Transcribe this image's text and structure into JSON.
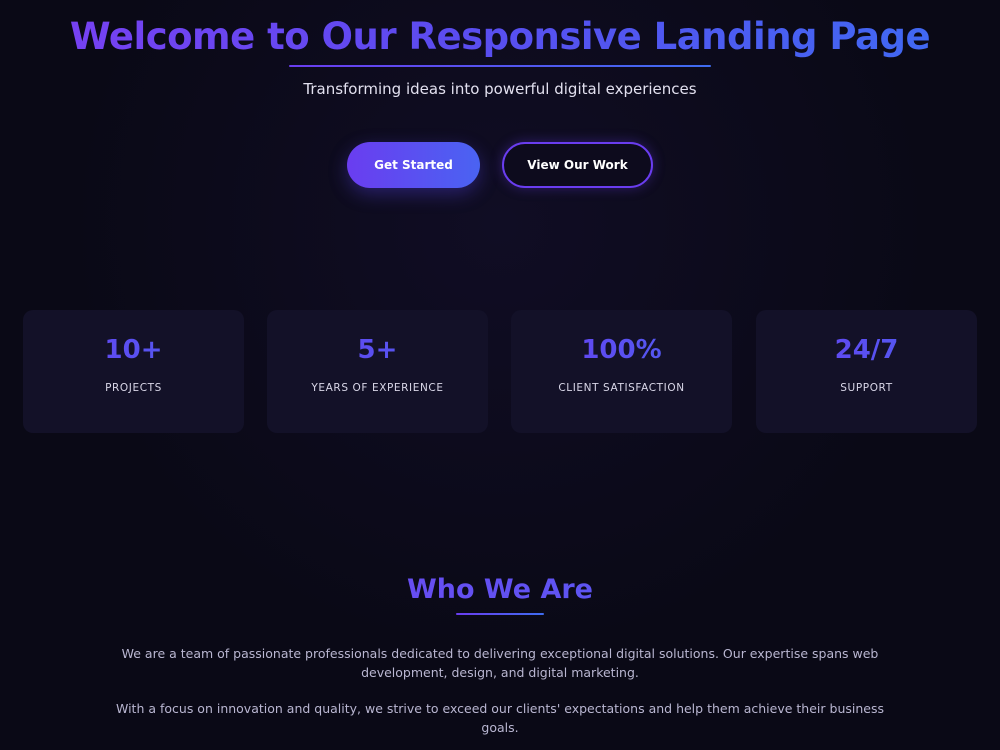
{
  "hero": {
    "title": "Welcome to Our Responsive Landing Page",
    "subtitle": "Transforming ideas into powerful digital experiences",
    "primary_button": "Get Started",
    "secondary_button": "View Our Work"
  },
  "stats": [
    {
      "value": "10+",
      "label": "PROJECTS"
    },
    {
      "value": "5+",
      "label": "YEARS OF EXPERIENCE"
    },
    {
      "value": "100%",
      "label": "CLIENT SATISFACTION"
    },
    {
      "value": "24/7",
      "label": "SUPPORT"
    }
  ],
  "about": {
    "title": "Who We Are",
    "paragraphs": [
      "We are a team of passionate professionals dedicated to delivering exceptional digital solutions. Our expertise spans web development, design, and digital marketing.",
      "With a focus on innovation and quality, we strive to exceed our clients' expectations and help them achieve their business goals."
    ]
  },
  "colors": {
    "background": "#0a0916",
    "accent_purple": "#6a3df0",
    "accent_blue": "#4a63f2",
    "card": "#131128"
  }
}
